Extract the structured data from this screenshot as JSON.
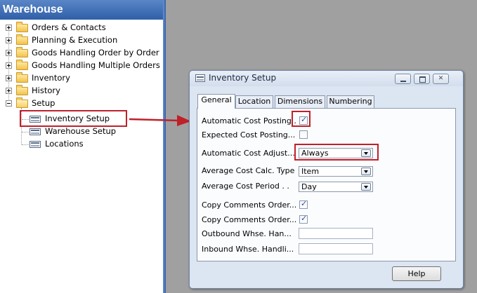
{
  "nav": {
    "header": "Warehouse",
    "items": [
      {
        "label": "Orders & Contacts"
      },
      {
        "label": "Planning & Execution"
      },
      {
        "label": "Goods Handling Order by Order"
      },
      {
        "label": "Goods Handling Multiple Orders"
      },
      {
        "label": "Inventory"
      },
      {
        "label": "History"
      },
      {
        "label": "Setup"
      }
    ],
    "setup_children": [
      {
        "label": "Inventory Setup"
      },
      {
        "label": "Warehouse Setup"
      },
      {
        "label": "Locations"
      }
    ]
  },
  "dialog": {
    "title": "Inventory Setup",
    "close_glyph": "✕",
    "tabs": [
      "General",
      "Location",
      "Dimensions",
      "Numbering"
    ],
    "active_tab": "General",
    "fields": {
      "automatic_cost_posting": {
        "label": "Automatic Cost Posting .",
        "checked": true
      },
      "expected_cost_posting": {
        "label": "Expected Cost Posting...",
        "checked": false
      },
      "automatic_cost_adjust": {
        "label": "Automatic Cost Adjust...",
        "value": "Always"
      },
      "average_cost_calc_type": {
        "label": "Average Cost Calc. Type",
        "value": "Item"
      },
      "average_cost_period": {
        "label": "Average Cost Period  .  .",
        "value": "Day"
      },
      "copy_comments_order_1": {
        "label": "Copy Comments Order...",
        "checked": true
      },
      "copy_comments_order_2": {
        "label": "Copy Comments Order...",
        "checked": true
      },
      "outbound_whse_handling": {
        "label": "Outbound Whse. Han...",
        "value": ""
      },
      "inbound_whse_handling": {
        "label": "Inbound Whse. Handli...",
        "value": ""
      }
    },
    "help_label": "Help"
  },
  "colors": {
    "highlight": "#c0202a",
    "nav_header": "#2f5fa8",
    "desktop": "#a0a0a0"
  }
}
